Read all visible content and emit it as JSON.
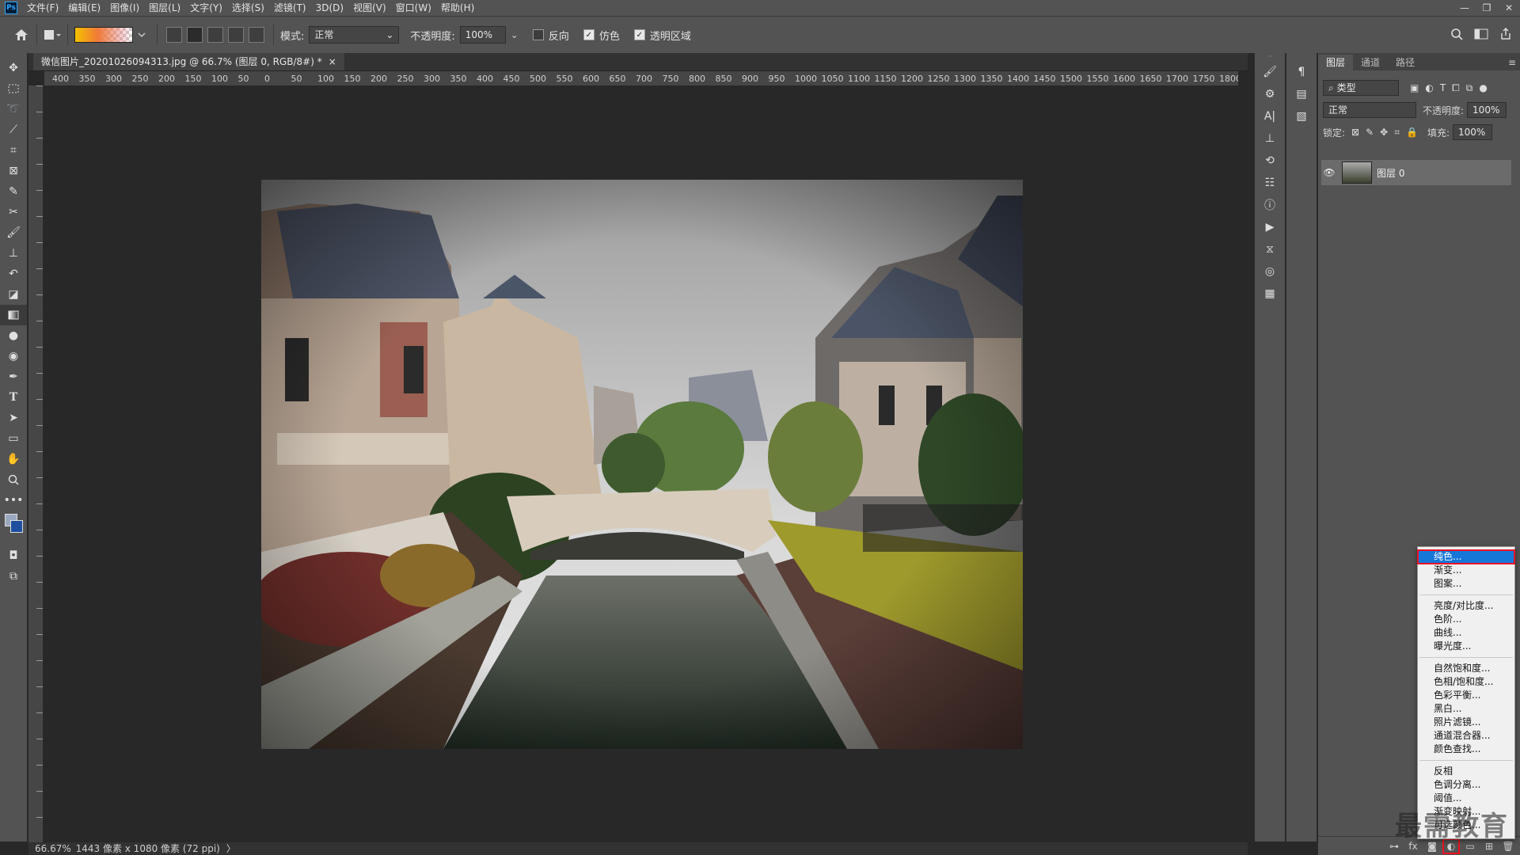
{
  "app": {
    "logo": "Ps"
  },
  "menubar": {
    "items": [
      "文件(F)",
      "编辑(E)",
      "图像(I)",
      "图层(L)",
      "文字(Y)",
      "选择(S)",
      "滤镜(T)",
      "3D(D)",
      "视图(V)",
      "窗口(W)",
      "帮助(H)"
    ]
  },
  "window_controls": {
    "minimize": "—",
    "restore": "❐",
    "close": "✕"
  },
  "options": {
    "mode_label": "模式:",
    "mode_value": "正常",
    "opacity_label": "不透明度:",
    "opacity_value": "100%",
    "reverse_label": "反向",
    "reverse_checked": false,
    "dither_label": "仿色",
    "dither_checked": true,
    "transparency_label": "透明区域",
    "transparency_checked": true
  },
  "document": {
    "tab_title": "微信图片_20201026094313.jpg @ 66.7% (图层 0, RGB/8#) *",
    "close": "×",
    "ruler_labels": [
      "400",
      "350",
      "300",
      "250",
      "200",
      "150",
      "100",
      "50",
      "0",
      "50",
      "100",
      "150",
      "200",
      "250",
      "300",
      "350",
      "400",
      "450",
      "500",
      "550",
      "600",
      "650",
      "700",
      "750",
      "800",
      "850",
      "900",
      "950",
      "1000",
      "1050",
      "1100",
      "1150",
      "1200",
      "1250",
      "1300",
      "1350",
      "1400",
      "1450",
      "1500",
      "1550",
      "1600",
      "1650",
      "1700",
      "1750",
      "1800"
    ]
  },
  "status": {
    "zoom": "66.67%",
    "info": "1443 像素 x 1080 像素 (72 ppi)",
    "arrow": "〉"
  },
  "layers_panel": {
    "tabs": [
      "图层",
      "通道",
      "路径"
    ],
    "filter_value": "类型",
    "blend_mode": "正常",
    "opacity_label": "不透明度:",
    "opacity_value": "100%",
    "lock_label": "锁定:",
    "fill_label": "填充:",
    "fill_value": "100%",
    "layer_name": "图层 0"
  },
  "adjust_menu": {
    "group1": [
      "纯色...",
      "渐变...",
      "图案..."
    ],
    "group2": [
      "亮度/对比度...",
      "色阶...",
      "曲线...",
      "曝光度..."
    ],
    "group3": [
      "自然饱和度...",
      "色相/饱和度...",
      "色彩平衡...",
      "黑白...",
      "照片滤镜...",
      "通道混合器...",
      "颜色查找..."
    ],
    "group4": [
      "反相",
      "色调分离...",
      "阈值...",
      "渐变映射...",
      "可选颜色..."
    ]
  },
  "watermark": "最需教育",
  "colors": {
    "accent": "#1677d9",
    "highlight_box": "#e12222",
    "panel": "#535353",
    "canvas": "#282828"
  }
}
